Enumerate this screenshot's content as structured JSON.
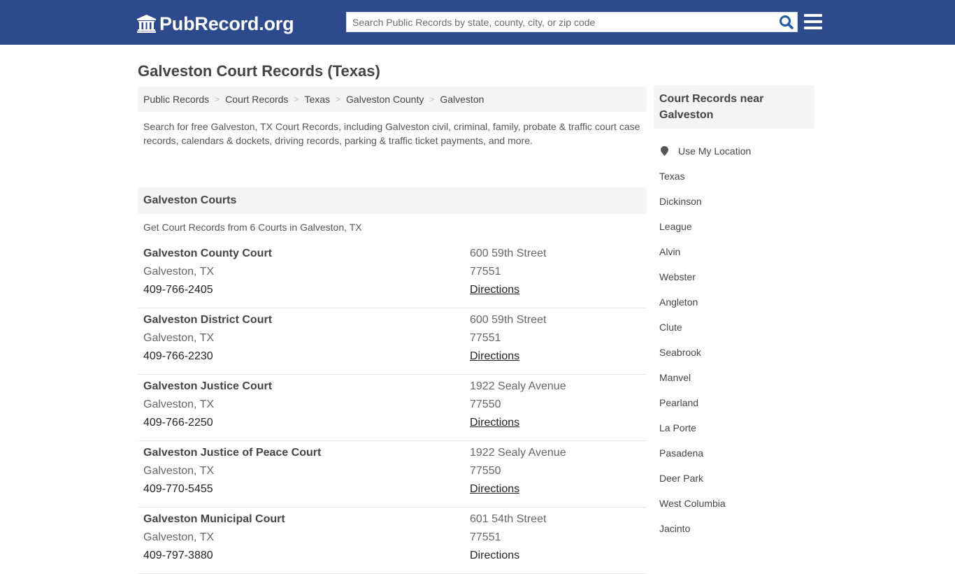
{
  "header": {
    "logo_text": "PubRecord.org",
    "search_placeholder": "Search Public Records by state, county, city, or zip code",
    "search_value": ""
  },
  "page": {
    "title": "Galveston Court Records (Texas)"
  },
  "breadcrumb": [
    {
      "label": "Public Records"
    },
    {
      "label": "Court Records"
    },
    {
      "label": "Texas"
    },
    {
      "label": "Galveston County"
    },
    {
      "label": "Galveston"
    }
  ],
  "breadcrumb_separator": ">",
  "intro": "Search for free Galveston, TX Court Records, including Galveston civil, criminal, family, probate & traffic court case records, calendars & dockets, driving records, parking & traffic ticket payments, and more.",
  "courts_section": {
    "heading": "Galveston Courts",
    "subtext": "Get Court Records from 6 Courts in Galveston, TX",
    "courts": [
      {
        "name": "Galveston County Court",
        "city": "Galveston, TX",
        "phone": "409-766-2405",
        "address": "600 59th Street",
        "zip": "77551",
        "directions": "Directions"
      },
      {
        "name": "Galveston District Court",
        "city": "Galveston, TX",
        "phone": "409-766-2230",
        "address": "600 59th Street",
        "zip": "77551",
        "directions": "Directions"
      },
      {
        "name": "Galveston Justice Court",
        "city": "Galveston, TX",
        "phone": "409-766-2250",
        "address": "1922 Sealy Avenue",
        "zip": "77550",
        "directions": "Directions"
      },
      {
        "name": "Galveston Justice of Peace Court",
        "city": "Galveston, TX",
        "phone": "409-770-5455",
        "address": "1922 Sealy Avenue",
        "zip": "77550",
        "directions": "Directions"
      },
      {
        "name": "Galveston Municipal Court",
        "city": "Galveston, TX",
        "phone": "409-797-3880",
        "address": "601 54th Street",
        "zip": "77551",
        "directions": "Directions"
      }
    ]
  },
  "sidebar": {
    "heading": "Court Records near Galveston",
    "use_location": "Use My Location",
    "items": [
      {
        "label": "Texas"
      },
      {
        "label": "Dickinson"
      },
      {
        "label": "League"
      },
      {
        "label": "Alvin"
      },
      {
        "label": "Webster"
      },
      {
        "label": "Angleton"
      },
      {
        "label": "Clute"
      },
      {
        "label": "Seabrook"
      },
      {
        "label": "Manvel"
      },
      {
        "label": "Pearland"
      },
      {
        "label": "La Porte"
      },
      {
        "label": "Pasadena"
      },
      {
        "label": "Deer Park"
      },
      {
        "label": "West Columbia"
      },
      {
        "label": "Jacinto"
      }
    ]
  },
  "colors": {
    "header_bg": "#2d4a8c",
    "search_icon": "#1f5aa6",
    "panel_bg": "#f4f4f4",
    "text": "#444444"
  }
}
